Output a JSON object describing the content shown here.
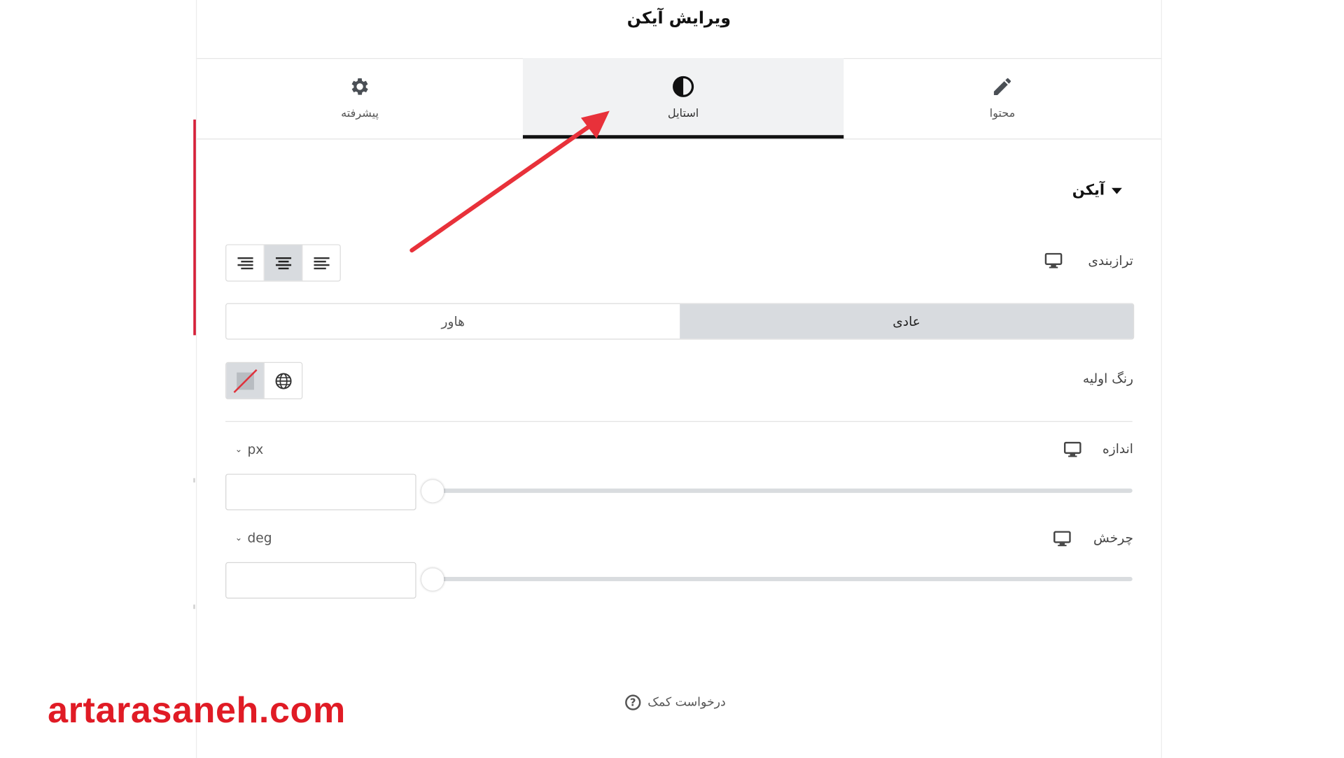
{
  "panel": {
    "title": "ویرایش آیکن"
  },
  "tabs": [
    {
      "label": "پیشرفته",
      "icon": "gear-icon"
    },
    {
      "label": "استایل",
      "icon": "half-circle-icon",
      "active": true
    },
    {
      "label": "محتوا",
      "icon": "pencil-icon"
    }
  ],
  "section": {
    "title": "آیکن"
  },
  "alignment": {
    "label": "ترازبندی",
    "options": [
      "align-right",
      "align-center",
      "align-left"
    ],
    "active": "align-center"
  },
  "state_toggle": {
    "normal": "عادی",
    "hover": "هاور",
    "active": "normal"
  },
  "primary_color": {
    "label": "رنگ اولیه"
  },
  "size": {
    "label": "اندازه",
    "unit": "px",
    "value": ""
  },
  "rotation": {
    "label": "چرخش",
    "unit": "deg",
    "value": ""
  },
  "help": {
    "label": "درخواست کمک",
    "icon_glyph": "?"
  },
  "watermark": {
    "text": "artarasaneh.com"
  },
  "colors": {
    "accent_red": "#e01b25",
    "active_tab_bg": "#f1f2f3",
    "toggle_active_bg": "#d8dbdf"
  }
}
